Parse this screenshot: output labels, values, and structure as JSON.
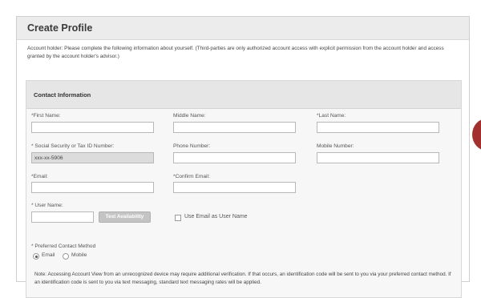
{
  "page": {
    "title": "Create Profile",
    "intro": "Account holder: Please complete the following information about yourself. (Third-parties are only authorized account access with explicit permission from the account holder and access granted by the account holder's advisor.)"
  },
  "section": {
    "title": "Contact Information"
  },
  "fields": {
    "first_name": {
      "label": "*First Name:",
      "value": ""
    },
    "middle_name": {
      "label": "Middle Name:",
      "value": ""
    },
    "last_name": {
      "label": "*Last Name:",
      "value": ""
    },
    "ssn": {
      "label": "* Social Security or Tax ID Number:",
      "value": "xxx-xx-5906"
    },
    "phone": {
      "label": "Phone Number:",
      "value": ""
    },
    "mobile": {
      "label": "Mobile Number:",
      "value": ""
    },
    "email": {
      "label": "*Email:",
      "value": ""
    },
    "confirm_email": {
      "label": "*Confirm Email:",
      "value": ""
    },
    "user_name": {
      "label": "* User Name:",
      "value": ""
    }
  },
  "buttons": {
    "test_availability": "Test Availability"
  },
  "use_email_checkbox": {
    "label": "Use Email as User Name",
    "checked": false
  },
  "preferred_contact": {
    "label": "* Preferred Contact Method",
    "options": [
      {
        "label": "Email",
        "selected": true
      },
      {
        "label": "Mobile",
        "selected": false
      }
    ]
  },
  "note": "Note: Accessing Account View from an unrecognized device may require additional verification. If that occurs, an identification code will be sent to you via your preferred contact method. If an identification code is sent to you via text messaging, standard text messaging rates will be applied.",
  "colors": {
    "accent_circle": "#a3302f",
    "disabled_button": "#c4c4c4",
    "disabled_field": "#dcdcdc"
  }
}
